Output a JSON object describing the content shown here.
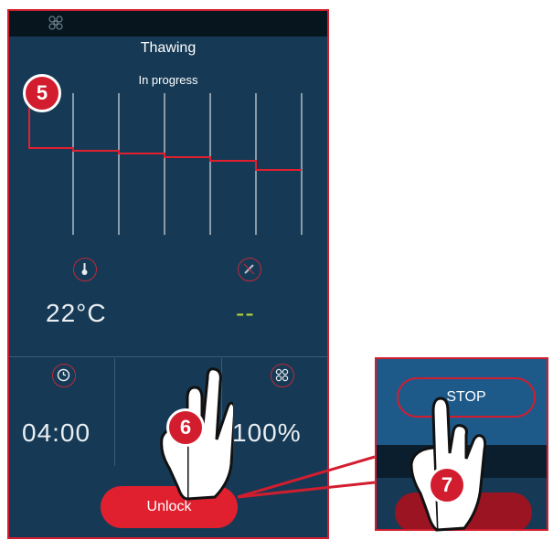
{
  "screen": {
    "title": "Thawing",
    "status": "In progress",
    "temperature": "22°C",
    "probe_value": "--",
    "timer": "04:00",
    "fan_speed": "100%",
    "unlock_label": "Unlock"
  },
  "inset": {
    "stop_label": "STOP"
  },
  "badges": [
    "5",
    "6",
    "7"
  ],
  "icons": [
    "fan-icon",
    "thermometer-icon",
    "probe-icon",
    "clock-icon",
    "hand-pointer-icon"
  ],
  "colors": {
    "panel": "#163a55",
    "accent": "#d21d2f",
    "value_green": "#b5d334"
  }
}
